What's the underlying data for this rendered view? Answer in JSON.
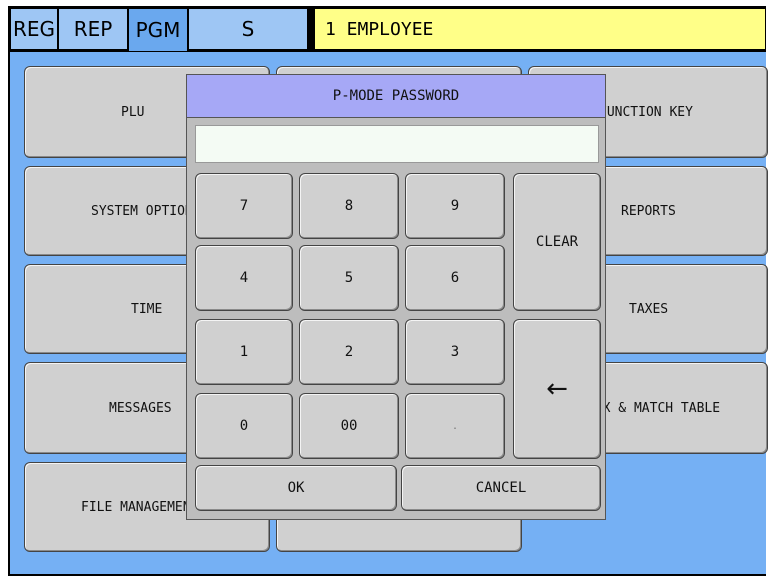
{
  "tabs": [
    {
      "label": "REG"
    },
    {
      "label": "REP"
    },
    {
      "label": "PGM"
    },
    {
      "label": "S"
    }
  ],
  "employee": "1 EMPLOYEE",
  "menu": {
    "plu": "PLU",
    "function_key": "FUNCTION KEY",
    "system_options": "SYSTEM OPTIONS",
    "reports": "REPORTS",
    "time": "TIME",
    "taxes": "TAXES",
    "messages": "MESSAGES",
    "mix_match_table": "MIX & MATCH TABLE",
    "file_management": "FILE MANAGEMENT"
  },
  "dialog": {
    "title": "P-MODE PASSWORD",
    "password_value": "",
    "keys": {
      "k7": "7",
      "k8": "8",
      "k9": "9",
      "k4": "4",
      "k5": "5",
      "k6": "6",
      "k1": "1",
      "k2": "2",
      "k3": "3",
      "k0": "0",
      "k00": "00",
      "dot": "."
    },
    "clear": "CLEAR",
    "backspace": "←",
    "ok": "OK",
    "cancel": "CANCEL"
  }
}
